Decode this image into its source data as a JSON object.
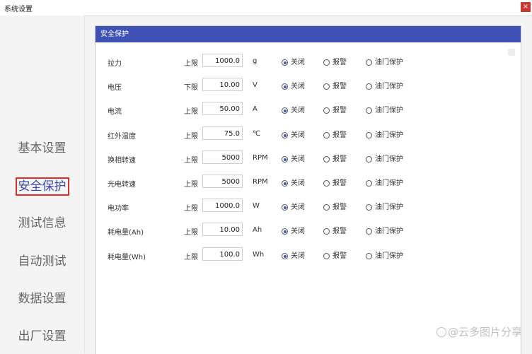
{
  "window": {
    "title": "系统设置",
    "close_label": "×"
  },
  "sidebar": {
    "items": [
      {
        "label": "基本设置",
        "active": false
      },
      {
        "label": "安全保护",
        "active": true
      },
      {
        "label": "测试信息",
        "active": false
      },
      {
        "label": "自动测试",
        "active": false
      },
      {
        "label": "数据设置",
        "active": false
      },
      {
        "label": "出厂设置",
        "active": false
      }
    ]
  },
  "panel": {
    "title": "安全保护",
    "options": [
      "关闭",
      "报警",
      "油门保护"
    ],
    "rows": [
      {
        "label": "拉力",
        "limit": "上限",
        "value": "1000.0",
        "unit": "g",
        "selected": 0
      },
      {
        "label": "电压",
        "limit": "下限",
        "value": "10.00",
        "unit": "V",
        "selected": 0
      },
      {
        "label": "电流",
        "limit": "上限",
        "value": "50.00",
        "unit": "A",
        "selected": 0
      },
      {
        "label": "红外温度",
        "limit": "上限",
        "value": "75.0",
        "unit": "℃",
        "selected": 0
      },
      {
        "label": "换相转速",
        "limit": "上限",
        "value": "5000",
        "unit": "RPM",
        "selected": 0
      },
      {
        "label": "光电转速",
        "limit": "上限",
        "value": "5000",
        "unit": "RPM",
        "selected": 0
      },
      {
        "label": "电功率",
        "limit": "上限",
        "value": "1000.0",
        "unit": "W",
        "selected": 0
      },
      {
        "label": "耗电量(Ah)",
        "limit": "上限",
        "value": "10.00",
        "unit": "Ah",
        "selected": 0
      },
      {
        "label": "耗电量(Wh)",
        "limit": "上限",
        "value": "100.0",
        "unit": "Wh",
        "selected": 0
      }
    ]
  },
  "watermark": "@云多图片分享",
  "colors": {
    "accent": "#3f51b5",
    "active_border": "#d6312a",
    "close": "#c9382f"
  }
}
